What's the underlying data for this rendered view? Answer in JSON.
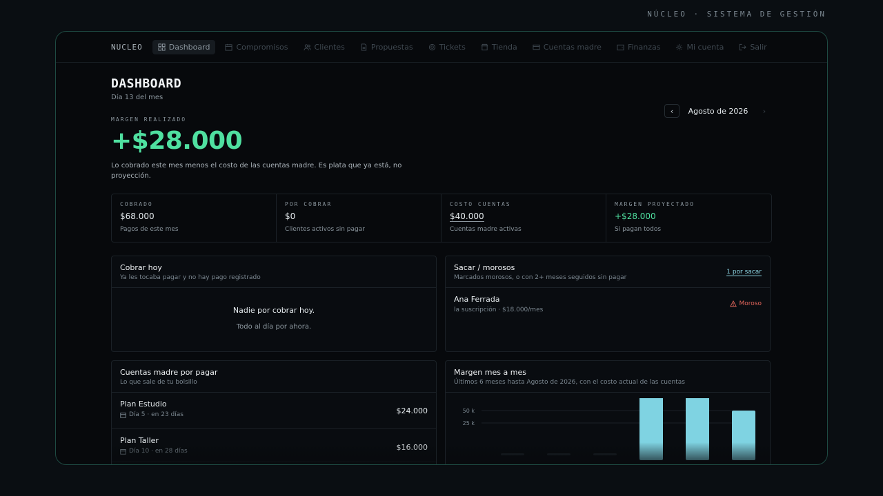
{
  "brand_top": "NÚCLEO · SISTEMA DE GESTIÓN",
  "nav": {
    "logo": "NUCLEO",
    "items": [
      {
        "label": "Dashboard",
        "icon": "grid-icon",
        "active": true
      },
      {
        "label": "Compromisos",
        "icon": "calendar-icon"
      },
      {
        "label": "Clientes",
        "icon": "users-icon"
      },
      {
        "label": "Propuestas",
        "icon": "document-icon"
      },
      {
        "label": "Tickets",
        "icon": "lifebuoy-icon"
      },
      {
        "label": "Tienda",
        "icon": "store-icon"
      },
      {
        "label": "Cuentas madre",
        "icon": "card-icon"
      },
      {
        "label": "Finanzas",
        "icon": "wallet-icon"
      },
      {
        "label": "Mi cuenta",
        "icon": "gear-icon"
      },
      {
        "label": "Salir",
        "icon": "logout-icon"
      }
    ]
  },
  "header": {
    "title": "DASHBOARD",
    "subtitle": "Día 13 del mes",
    "month": "Agosto de 2026"
  },
  "margin": {
    "label": "MARGEN REALIZADO",
    "value": "+$28.000",
    "description": "Lo cobrado este mes menos el costo de las cuentas madre. Es plata que ya está, no proyección."
  },
  "stats": [
    {
      "label": "COBRADO",
      "value": "$68.000",
      "note": "Pagos de este mes"
    },
    {
      "label": "POR COBRAR",
      "value": "$0",
      "note": "Clientes activos sin pagar"
    },
    {
      "label": "COSTO CUENTAS",
      "value": "$40.000",
      "note": "Cuentas madre activas"
    },
    {
      "label": "MARGEN PROYECTADO",
      "value": "+$28.000",
      "note": "Si pagan todos"
    }
  ],
  "cobrar_hoy": {
    "title": "Cobrar hoy",
    "subtitle": "Ya les tocaba pagar y no hay pago registrado",
    "empty_title": "Nadie por cobrar hoy.",
    "empty_sub": "Todo al día por ahora."
  },
  "morosos": {
    "title": "Sacar / morosos",
    "subtitle": "Marcados morosos, o con 2+ meses seguidos sin pagar",
    "link": "1 por sacar",
    "rows": [
      {
        "name": "Ana Ferrada",
        "meta": "la suscripción · $18.000/mes",
        "status": "Moroso"
      }
    ]
  },
  "cuentas": {
    "title": "Cuentas madre por pagar",
    "subtitle": "Lo que sale de tu bolsillo",
    "rows": [
      {
        "name": "Plan Estudio",
        "meta": "Día 5 · en 23 días",
        "amount": "$24.000"
      },
      {
        "name": "Plan Taller",
        "meta": "Día 10 · en 28 días",
        "amount": "$16.000"
      }
    ]
  },
  "margen_chart": {
    "title": "Margen mes a mes",
    "subtitle": "Últimos 6 meses hasta Agosto de 2026, con el costo actual de las cuentas"
  },
  "chart_data": {
    "type": "bar",
    "categories": [
      "",
      "",
      "",
      "",
      "",
      ""
    ],
    "values": [
      0,
      0,
      0,
      68000,
      68000,
      50000
    ],
    "yticks": [
      "50 k",
      "25 k"
    ],
    "ytick_values": [
      50000,
      25000
    ],
    "ylim": [
      0,
      50000
    ],
    "color": "#7fd3e2"
  },
  "colors": {
    "accent_green": "#4fe0a0",
    "danger": "#e0655a",
    "link": "#8fd8e6"
  }
}
